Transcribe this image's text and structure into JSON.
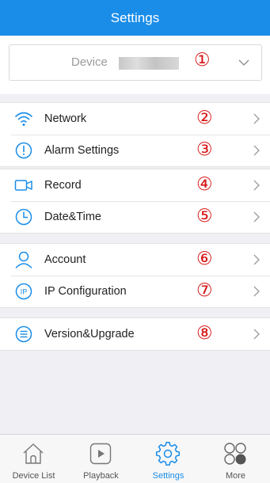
{
  "header": {
    "title": "Settings"
  },
  "device": {
    "label": "Device",
    "number": "①"
  },
  "groups": [
    {
      "items": [
        {
          "label": "Network",
          "number": "②",
          "icon": "wifi-icon"
        },
        {
          "label": "Alarm Settings",
          "number": "③",
          "icon": "alert-circle-icon"
        }
      ]
    },
    {
      "items": [
        {
          "label": "Record",
          "number": "④",
          "icon": "video-camera-icon"
        },
        {
          "label": "Date&Time",
          "number": "⑤",
          "icon": "clock-icon"
        }
      ]
    },
    {
      "items": [
        {
          "label": "Account",
          "number": "⑥",
          "icon": "user-icon"
        },
        {
          "label": "IP Configuration",
          "number": "⑦",
          "icon": "ip-icon"
        }
      ]
    },
    {
      "items": [
        {
          "label": "Version&Upgrade",
          "number": "⑧",
          "icon": "list-circle-icon"
        }
      ]
    }
  ],
  "tabs": [
    {
      "label": "Device List",
      "icon": "home-icon",
      "active": false
    },
    {
      "label": "Playback",
      "icon": "play-icon",
      "active": false
    },
    {
      "label": "Settings",
      "icon": "gear-icon",
      "active": true
    },
    {
      "label": "More",
      "icon": "more-circles-icon",
      "active": false
    }
  ],
  "colors": {
    "accent": "#1a8de8",
    "number_red": "#d81515",
    "background": "#efeff4"
  }
}
